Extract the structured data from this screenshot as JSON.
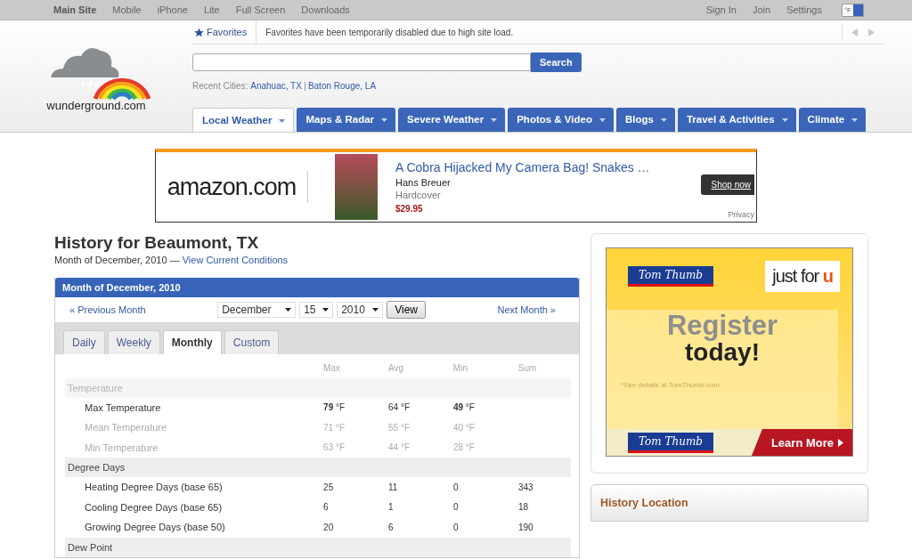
{
  "top_bar": {
    "left_links": [
      {
        "label": "Main Site",
        "selected": true
      },
      {
        "label": "Mobile",
        "selected": false
      },
      {
        "label": "iPhone",
        "selected": false
      },
      {
        "label": "Lite",
        "selected": false
      },
      {
        "label": "Full Screen",
        "selected": false
      },
      {
        "label": "Downloads",
        "selected": false
      }
    ],
    "right_links": [
      "Sign In",
      "Join",
      "Settings"
    ],
    "unit_toggle": "°F"
  },
  "header": {
    "logo_text": "wunderground.com",
    "favorites_label": "Favorites",
    "favorites_notice": "Favorites have been temporarily disabled due to high site load.",
    "search_button": "Search",
    "recent_label": "Recent Cities:",
    "recent_cities": [
      "Anahuac, TX",
      "Baton Rouge, LA"
    ],
    "nav_tabs": [
      {
        "label": "Local Weather",
        "selected": true
      },
      {
        "label": "Maps & Radar",
        "selected": false
      },
      {
        "label": "Severe Weather",
        "selected": false
      },
      {
        "label": "Photos & Video",
        "selected": false
      },
      {
        "label": "Blogs",
        "selected": false
      },
      {
        "label": "Travel & Activities",
        "selected": false
      },
      {
        "label": "Climate",
        "selected": false
      }
    ]
  },
  "ad_banner": {
    "brand": "amazon.com",
    "title": "A Cobra Hijacked My Camera Bag! Snakes …",
    "author": "Hans Breuer",
    "format": "Hardcover",
    "price": "$29.95",
    "button": "Shop now",
    "privacy": "Privacy"
  },
  "page_title": "History for Beaumont, TX",
  "subtitle": "Month of December, 2010 —",
  "subtitle_link": "View Current Conditions",
  "history_panel": {
    "header": "Month of December, 2010",
    "prev_link": "« Previous Month",
    "next_link": "Next Month »",
    "month": "December",
    "day": "15",
    "year": "2010",
    "view_button": "View",
    "tabs": [
      {
        "label": "Daily",
        "selected": false
      },
      {
        "label": "Weekly",
        "selected": false
      },
      {
        "label": "Monthly",
        "selected": true
      },
      {
        "label": "Custom",
        "selected": false
      }
    ],
    "columns": [
      "Max",
      "Avg",
      "Min",
      "Sum"
    ],
    "rows": [
      {
        "kind": "group",
        "label": "Temperature",
        "muted": true
      },
      {
        "kind": "row",
        "label": "Max Temperature",
        "muted": false,
        "cells": [
          "**79** °F",
          "64 °F",
          "**49** °F",
          ""
        ]
      },
      {
        "kind": "row",
        "label": "Mean Temperature",
        "muted": true,
        "cells": [
          "71 °F",
          "55 °F",
          "40 °F",
          ""
        ]
      },
      {
        "kind": "row",
        "label": "Min Temperature",
        "muted": true,
        "cells": [
          "63 °F",
          "44 °F",
          "28 °F",
          ""
        ]
      },
      {
        "kind": "group",
        "label": "Degree Days",
        "muted": false
      },
      {
        "kind": "row",
        "label": "Heating Degree Days (base 65)",
        "muted": false,
        "cells": [
          "25",
          "11",
          "0",
          "343"
        ]
      },
      {
        "kind": "row",
        "label": "Cooling Degree Days (base 65)",
        "muted": false,
        "cells": [
          "6",
          "1",
          "0",
          "18"
        ]
      },
      {
        "kind": "row",
        "label": "Growing Degree Days (base 50)",
        "muted": false,
        "cells": [
          "20",
          "6",
          "0",
          "190"
        ]
      },
      {
        "kind": "group",
        "label": "Dew Point",
        "muted": false
      }
    ]
  },
  "side_ad": {
    "store_logo": "Tom Thumb",
    "tagline": "just for",
    "tagline_mark": "u",
    "headline_1": "Register",
    "headline_2": "today!",
    "fine_print": "*See details at TomThumb.com",
    "footer_logo": "Tom Thumb",
    "button": "Learn More"
  },
  "history_location": {
    "title": "History Location"
  }
}
